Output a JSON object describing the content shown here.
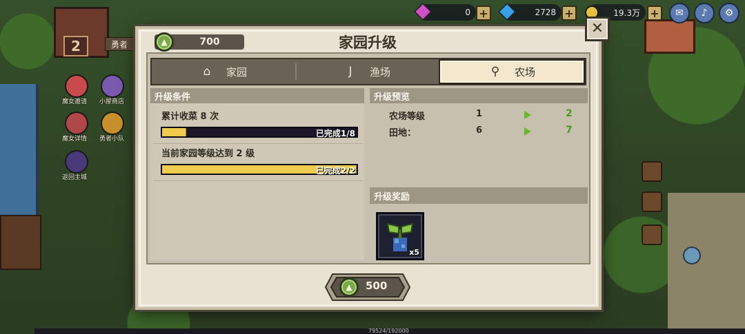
{
  "hud": {
    "gems": "0",
    "diamonds": "2728",
    "gold": "19.3万",
    "plus_label": "+",
    "colors": {
      "gem": "#d050c8",
      "diamond": "#3aa0e8",
      "gold": "#e8c040"
    }
  },
  "scene": {
    "house_level": "2",
    "hero_tag": "勇者",
    "side_buttons": [
      "魔女邀请",
      "小屋商店",
      "魔女详情",
      "勇者小队",
      "返回主城"
    ],
    "xp_text": "79524/192000"
  },
  "dialog": {
    "title": "家园升级",
    "current_resource": "700",
    "close_label": "✕",
    "tabs": [
      {
        "label": "家园",
        "icon": "house-icon",
        "active": false
      },
      {
        "label": "渔场",
        "icon": "fishhook-icon",
        "active": false
      },
      {
        "label": "农场",
        "icon": "shovel-icon",
        "active": true
      }
    ],
    "conditions": {
      "heading": "升级条件",
      "items": [
        {
          "text": "累计收菜 8 次",
          "progress_label": "已完成1/8",
          "progress": 0.125
        },
        {
          "text": "当前家园等级达到 2 级",
          "progress_label": "已完成2/2",
          "progress": 1.0
        }
      ]
    },
    "preview": {
      "heading": "升级预览",
      "rows": [
        {
          "label": "农场等级",
          "current": "1",
          "next": "2"
        },
        {
          "label": "田地：",
          "current": "6",
          "next": "7"
        }
      ]
    },
    "rewards": {
      "heading": "升级奖励",
      "items": [
        {
          "name": "sprout-seed-icon",
          "count": "x5"
        }
      ]
    },
    "upgrade_button": {
      "cost": "500"
    },
    "resource_icon_glyph": "▲"
  }
}
